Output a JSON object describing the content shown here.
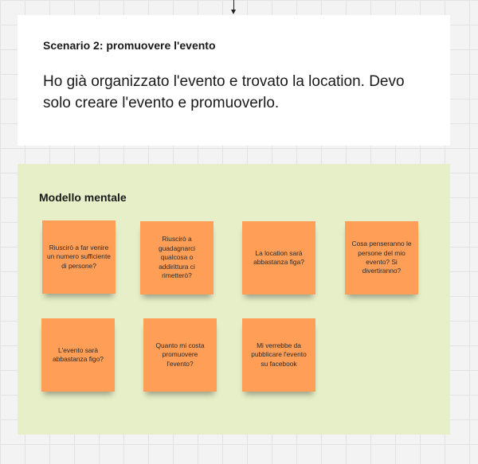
{
  "scenario": {
    "title": "Scenario 2: promuovere l'evento",
    "body": "Ho già organizzato l'evento e trovato la location. Devo solo creare l'evento e promuoverlo."
  },
  "mental_model": {
    "title": "Modello mentale",
    "notes": [
      "Riuscirò a far venire un numero sufficiente di persone?",
      "Riuscirò a guadagnarci qualcosa o addirittura ci rimetterò?",
      "La location sarà abbastanza figa?",
      "Cosa penseranno le persone del mio evento? Si divertiranno?",
      "L'evento sarà abbastanza figo?",
      "Quanto mi costa promuovere l'evento?",
      "Mi verrebbe da pubblicare l'evento su facebook"
    ]
  },
  "colors": {
    "sticky": "#ff9e57",
    "frame": "#e7efc8",
    "card": "#ffffff"
  }
}
